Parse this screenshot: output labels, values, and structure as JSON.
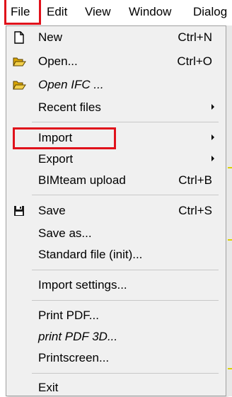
{
  "menubar": {
    "items": [
      "File",
      "Edit",
      "View",
      "Window",
      "Dialog"
    ]
  },
  "file_menu": {
    "new": {
      "label": "New",
      "shortcut": "Ctrl+N",
      "icon": "new-document-icon"
    },
    "open": {
      "label": "Open...",
      "shortcut": "Ctrl+O",
      "icon": "open-folder-icon"
    },
    "open_ifc": {
      "label": "Open IFC ...",
      "icon": "open-folder-icon"
    },
    "recent_files": {
      "label": "Recent files"
    },
    "import": {
      "label": "Import"
    },
    "export": {
      "label": "Export"
    },
    "bimteam_upload": {
      "label": "BIMteam upload",
      "shortcut": "Ctrl+B"
    },
    "save": {
      "label": "Save",
      "shortcut": "Ctrl+S",
      "icon": "floppy-disk-icon"
    },
    "save_as": {
      "label": "Save as..."
    },
    "standard_file": {
      "label": "Standard file (init)..."
    },
    "import_settings": {
      "label": "Import settings..."
    },
    "print_pdf": {
      "label": "Print PDF..."
    },
    "print_pdf_3d": {
      "label": "print PDF 3D..."
    },
    "printscreen": {
      "label": "Printscreen..."
    },
    "exit": {
      "label": "Exit"
    }
  },
  "colors": {
    "highlight": "#e0111b",
    "menu_bg": "#f0f0f0",
    "folder_icon": "#d8a400"
  }
}
